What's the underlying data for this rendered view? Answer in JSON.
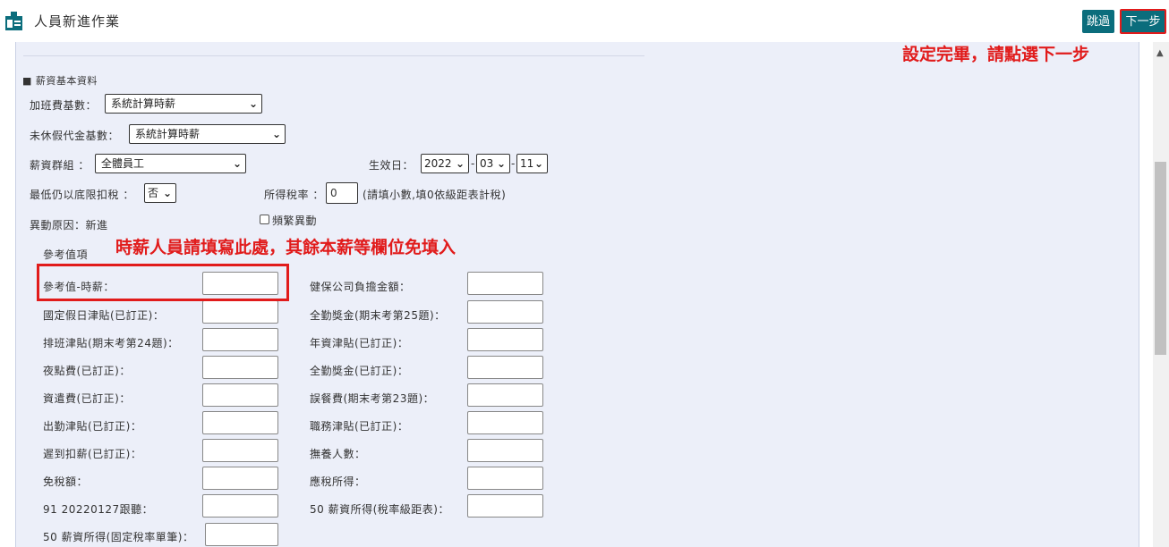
{
  "header": {
    "title": "人員新進作業",
    "skip_label": "跳過",
    "next_label": "下一步",
    "icon": "id-card-icon"
  },
  "annotations": {
    "top": "設定完畢，請點選下一步",
    "middle": "時薪人員請填寫此處，其餘本薪等欄位免填入"
  },
  "form": {
    "section_title": "■ 薪資基本資料",
    "overtime_base_label": "加班費基數：",
    "overtime_base_value": "系統計算時薪",
    "leave_pay_base_label": "未休假代金基數：",
    "leave_pay_base_value": "系統計算時薪",
    "salary_group_label": "薪資群組 ：",
    "salary_group_value": "全體員工",
    "effective_date_label": "生效日：",
    "effective_year": "2022",
    "effective_month": "03",
    "effective_day": "11",
    "min_tax_label": "最低仍以底限扣稅 ：",
    "min_tax_value": "否",
    "tax_rate_label": "所得稅率 ：",
    "tax_rate_value": "0",
    "tax_rate_hint": "(請填小數,填0依級距表計稅)",
    "change_reason": "異動原因：新進",
    "frequent_change_label": "頻繁異動",
    "reference_section": "參考值項"
  },
  "fields_left": [
    {
      "label": "參考值-時薪：",
      "value": ""
    },
    {
      "label": "國定假日津貼(已訂正)：",
      "value": ""
    },
    {
      "label": "排班津貼(期末考第24題)：",
      "value": ""
    },
    {
      "label": "夜點費(已訂正)：",
      "value": ""
    },
    {
      "label": "資遣費(已訂正)：",
      "value": ""
    },
    {
      "label": "出勤津貼(已訂正)：",
      "value": ""
    },
    {
      "label": "遲到扣薪(已訂正)：",
      "value": ""
    },
    {
      "label": "免稅額：",
      "value": ""
    },
    {
      "label": "91 20220127跟聽：",
      "value": ""
    },
    {
      "label": "50 薪資所得(固定稅率單筆)：",
      "value": ""
    }
  ],
  "fields_right": [
    {
      "label": "健保公司負擔金額：",
      "value": ""
    },
    {
      "label": "全勤獎金(期末考第25題)：",
      "value": ""
    },
    {
      "label": "年資津貼(已訂正)：",
      "value": ""
    },
    {
      "label": "全勤獎金(已訂正)：",
      "value": ""
    },
    {
      "label": "誤餐費(期末考第23題)：",
      "value": ""
    },
    {
      "label": "職務津貼(已訂正)：",
      "value": ""
    },
    {
      "label": "撫養人數：",
      "value": ""
    },
    {
      "label": "應稅所得：",
      "value": ""
    },
    {
      "label": "50 薪資所得(稅率級距表)：",
      "value": ""
    }
  ],
  "colors": {
    "accent": "#0b6d7c",
    "annotation": "#e11b1b",
    "panel": "#eceff9"
  }
}
